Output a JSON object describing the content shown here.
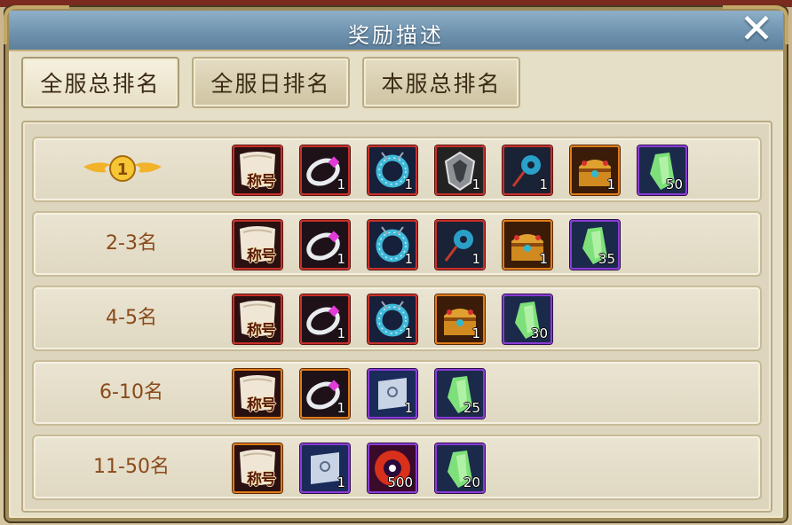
{
  "dialog": {
    "title": "奖励描述",
    "close_symbol": "✕"
  },
  "tabs": [
    {
      "label": "全服总排名",
      "active": true
    },
    {
      "label": "全服日排名",
      "active": false
    },
    {
      "label": "本服总排名",
      "active": false
    }
  ],
  "rows": [
    {
      "rank_label": "1",
      "rank_icon": "gold-winged-medal-icon",
      "items": [
        {
          "icon": "title-scroll-icon",
          "text": "称号",
          "qty": "",
          "frame": "red"
        },
        {
          "icon": "ring-icon",
          "qty": "1",
          "frame": "red"
        },
        {
          "icon": "necklace-icon",
          "qty": "1",
          "frame": "red"
        },
        {
          "icon": "armor-icon",
          "qty": "1",
          "frame": "red"
        },
        {
          "icon": "jade-pendant-icon",
          "qty": "1",
          "frame": "red"
        },
        {
          "icon": "treasure-chest-icon",
          "qty": "1",
          "frame": "orange"
        },
        {
          "icon": "green-crystal-icon",
          "qty": "50",
          "frame": "purple"
        }
      ]
    },
    {
      "rank_label": "2-3名",
      "items": [
        {
          "icon": "title-scroll-icon",
          "text": "称号",
          "qty": "",
          "frame": "red"
        },
        {
          "icon": "ring-icon",
          "qty": "1",
          "frame": "red"
        },
        {
          "icon": "necklace-icon",
          "qty": "1",
          "frame": "red"
        },
        {
          "icon": "jade-pendant-icon",
          "qty": "1",
          "frame": "red"
        },
        {
          "icon": "treasure-chest-icon",
          "qty": "1",
          "frame": "orange"
        },
        {
          "icon": "green-crystal-icon",
          "qty": "35",
          "frame": "purple"
        }
      ]
    },
    {
      "rank_label": "4-5名",
      "items": [
        {
          "icon": "title-scroll-icon",
          "text": "称号",
          "qty": "",
          "frame": "red"
        },
        {
          "icon": "ring-icon",
          "qty": "1",
          "frame": "red"
        },
        {
          "icon": "necklace-icon",
          "qty": "1",
          "frame": "red"
        },
        {
          "icon": "treasure-chest-icon",
          "qty": "1",
          "frame": "orange"
        },
        {
          "icon": "green-crystal-icon",
          "qty": "30",
          "frame": "purple"
        }
      ]
    },
    {
      "rank_label": "6-10名",
      "items": [
        {
          "icon": "title-scroll-icon",
          "text": "称号",
          "qty": "",
          "frame": "orange"
        },
        {
          "icon": "ring-icon",
          "qty": "1",
          "frame": "orange"
        },
        {
          "icon": "silver-scroll-icon",
          "qty": "1",
          "frame": "purple"
        },
        {
          "icon": "green-crystal-icon",
          "qty": "25",
          "frame": "purple"
        }
      ]
    },
    {
      "rank_label": "11-50名",
      "items": [
        {
          "icon": "title-scroll-icon",
          "text": "称号",
          "qty": "",
          "frame": "orange"
        },
        {
          "icon": "silver-scroll-icon",
          "qty": "1",
          "frame": "purple"
        },
        {
          "icon": "red-orb-icon",
          "qty": "500",
          "frame": "purple"
        },
        {
          "icon": "green-crystal-icon",
          "qty": "20",
          "frame": "purple"
        }
      ]
    }
  ],
  "colors": {
    "rank_text": "#8a4a1a",
    "frame_red": "#c7302a",
    "frame_orange": "#e07c1a",
    "frame_purple": "#8a3bd6"
  }
}
